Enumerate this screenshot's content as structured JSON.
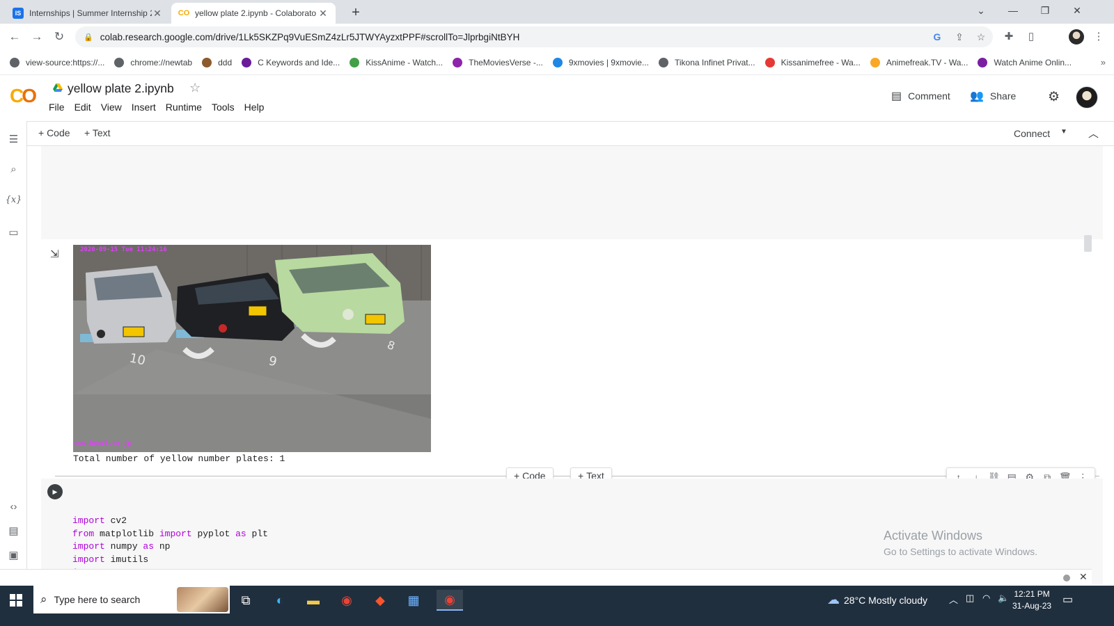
{
  "browser": {
    "tabs": [
      {
        "title": "Internships | Summer Internship 2",
        "favicon": "IS",
        "active": false
      },
      {
        "title": "yellow plate 2.ipynb - Colaborato",
        "favicon": "CO",
        "active": true
      }
    ],
    "url": "colab.research.google.com/drive/1Lk5SKZPq9VuESmZ4zLr5JTWYAyzxtPPF#scrollTo=JlprbgiNtBYH",
    "bookmarks": [
      {
        "label": "view-source:https://...",
        "color": "#5f6368"
      },
      {
        "label": "chrome://newtab",
        "color": "#5f6368"
      },
      {
        "label": "ddd",
        "color": "#8d5a2b"
      },
      {
        "label": "C Keywords and Ide...",
        "color": "#6a1b9a"
      },
      {
        "label": "KissAnime - Watch...",
        "color": "#43a047"
      },
      {
        "label": "TheMoviesVerse -...",
        "color": "#8e24aa"
      },
      {
        "label": "9xmovies | 9xmovie...",
        "color": "#1e88e5"
      },
      {
        "label": "Tikona Infinet Privat...",
        "color": "#5f6368"
      },
      {
        "label": "Kissanimefree - Wa...",
        "color": "#e53935"
      },
      {
        "label": "Animefreak.TV - Wa...",
        "color": "#f9a825"
      },
      {
        "label": "Watch Anime Onlin...",
        "color": "#7b1fa2"
      }
    ]
  },
  "colab": {
    "notebook_title": "yellow plate 2.ipynb",
    "menu": [
      "File",
      "Edit",
      "View",
      "Insert",
      "Runtime",
      "Tools",
      "Help"
    ],
    "comment_label": "Comment",
    "share_label": "Share",
    "add_code_label": "+ Code",
    "add_text_label": "+ Text",
    "connect_label": "Connect",
    "output_text": "Total number of yellow number plates: 1",
    "image_overlay_top": "2020-09-15 Tue 11:24:16",
    "image_overlay_bottom": "www.heazl.co.jp",
    "inline_add_code": "Code",
    "inline_add_text": "Text",
    "code_lines": [
      [
        {
          "kw": "import"
        },
        {
          "t": " cv2"
        }
      ],
      [
        {
          "kw": "from"
        },
        {
          "t": " matplotlib "
        },
        {
          "kw": "import"
        },
        {
          "t": " pyplot "
        },
        {
          "kw": "as"
        },
        {
          "t": " plt"
        }
      ],
      [
        {
          "kw": "import"
        },
        {
          "t": " numpy "
        },
        {
          "kw": "as"
        },
        {
          "t": " np"
        }
      ],
      [
        {
          "kw": "import"
        },
        {
          "t": " imutils"
        }
      ],
      [
        {
          "kw": "import"
        },
        {
          "t": " easyocr"
        }
      ]
    ]
  },
  "watermark": {
    "title": "Activate Windows",
    "subtitle": "Go to Settings to activate Windows."
  },
  "taskbar": {
    "search_placeholder": "Type here to search",
    "temperature": "28°C",
    "weather": "Mostly cloudy",
    "time": "12:21 PM",
    "date": "31-Aug-23"
  },
  "colors": {
    "keyword": "#af00db",
    "colab_orange": "#f9ab00",
    "taskbar": "#202f3e"
  }
}
